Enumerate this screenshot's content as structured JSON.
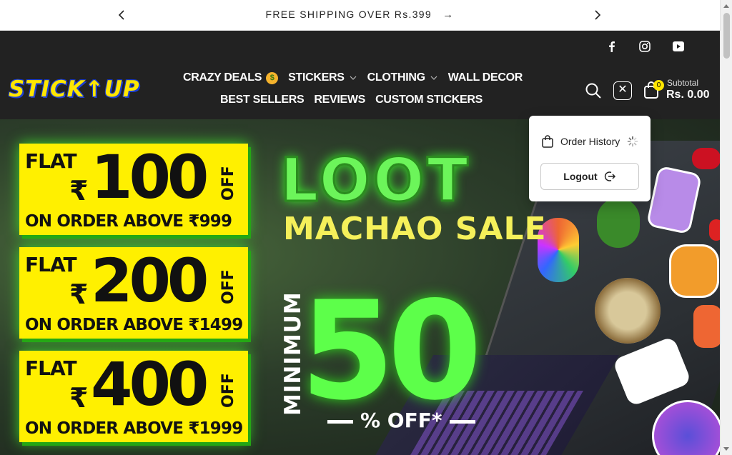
{
  "announcement": {
    "text": "FREE SHIPPING OVER Rs.399",
    "arrow_glyph": "→",
    "prev_glyph": "‹",
    "next_glyph": "›"
  },
  "header": {
    "logo_text": "STICK↑UP",
    "nav_row1": [
      {
        "label": "CRAZY DEALS",
        "emoji": "🤑",
        "dropdown": false
      },
      {
        "label": "STICKERS",
        "dropdown": true
      },
      {
        "label": "CLOTHING",
        "dropdown": true
      },
      {
        "label": "WALL DECOR",
        "dropdown": false
      }
    ],
    "nav_row2": [
      {
        "label": "BEST SELLERS"
      },
      {
        "label": "REVIEWS"
      },
      {
        "label": "CUSTOM STICKERS"
      }
    ],
    "social_icons": [
      "facebook-icon",
      "instagram-icon",
      "youtube-icon"
    ],
    "cart": {
      "count": "0",
      "subtotal_label": "Subtotal",
      "subtotal_value": "Rs. 0.00"
    },
    "close_glyph": "✕"
  },
  "account_dropdown": {
    "order_history": "Order History",
    "logout": "Logout"
  },
  "hero": {
    "offers": [
      {
        "flat": "FLAT",
        "currency": "₹",
        "amount": "100",
        "off": "OFF",
        "condition": "ON ORDER ABOVE ₹999"
      },
      {
        "flat": "FLAT",
        "currency": "₹",
        "amount": "200",
        "off": "OFF",
        "condition": "ON ORDER ABOVE ₹1499"
      },
      {
        "flat": "FLAT",
        "currency": "₹",
        "amount": "400",
        "off": "OFF",
        "condition": "ON ORDER ABOVE ₹1999"
      }
    ],
    "headline": "LOOT",
    "subheadline": "MACHAO SALE",
    "minimum_label": "MINIMUM",
    "discount_value": "50",
    "discount_suffix": "% OFF*",
    "colors": {
      "offer_bg": "#fff000",
      "neon_green": "#5dff4a",
      "yellow_text": "#f5f05a"
    }
  }
}
